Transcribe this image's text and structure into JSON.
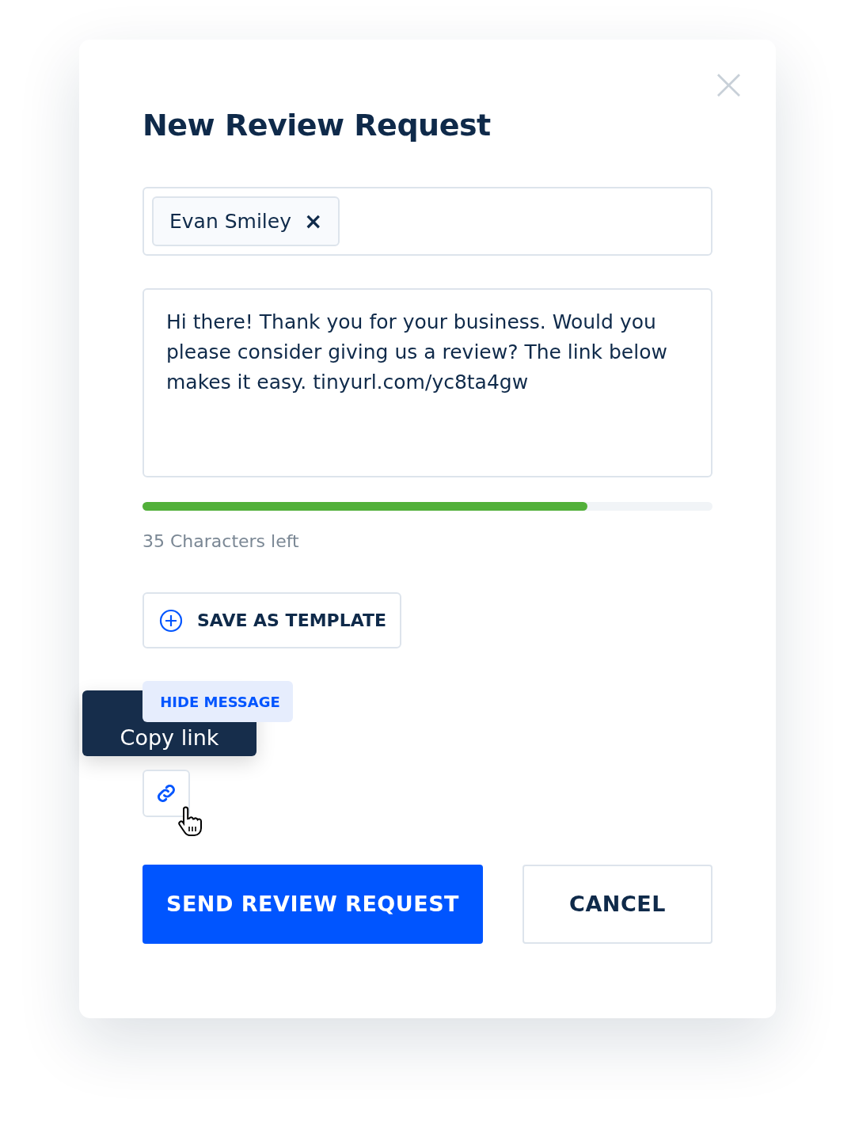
{
  "dialog": {
    "title": "New Review Request",
    "close": "×"
  },
  "recipients": [
    {
      "name": "Evan Smiley",
      "remove": "×"
    }
  ],
  "message": {
    "value": "Hi there! Thank you for your business. Would you please consider giving us a review? The link below makes it easy. tinyurl.com/yc8ta4gw"
  },
  "counter": {
    "level": 0.78,
    "label": "35 Characters left"
  },
  "save_template": {
    "label": "SAVE AS TEMPLATE"
  },
  "hide_message": {
    "label": "HIDE MESSAGE"
  },
  "tooltip": {
    "text": "Copy link"
  },
  "buttons": [
    {
      "kind": "primary",
      "label": "SEND REVIEW REQUEST"
    },
    {
      "kind": "secondary",
      "label": "CANCEL"
    }
  ]
}
